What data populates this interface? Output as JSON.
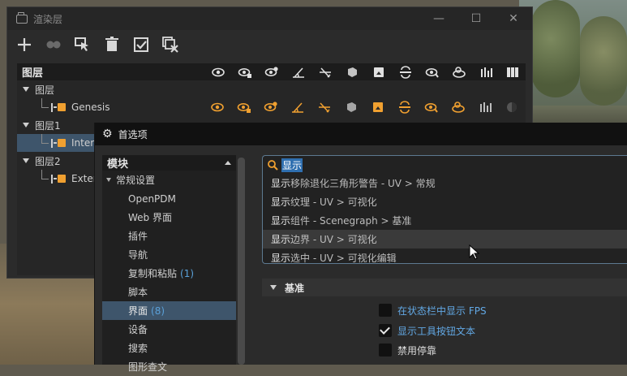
{
  "layers_window": {
    "title": "渲染层",
    "controls": {
      "minimize": "—",
      "maximize": "☐",
      "close": "✕"
    },
    "toolbar": [
      "add-icon",
      "link-icon",
      "select-render-icon",
      "delete-icon",
      "checkbox-icon",
      "clear-icon"
    ],
    "tree_header": "图层",
    "column_icons": [
      "eye-icon",
      "eye-lock-icon",
      "eye-settings-icon",
      "angle-icon",
      "angle-slash-icon",
      "cube-icon",
      "cube-fill-icon",
      "split-icon",
      "eye-pin-icon",
      "shape-icon",
      "bars-icon",
      "columns-icon"
    ],
    "rows": [
      {
        "label": "图层",
        "type": "group"
      },
      {
        "label": "Genesis",
        "type": "layer"
      },
      {
        "label": "图层1",
        "type": "group"
      },
      {
        "label": "Interi",
        "type": "layer",
        "selected": true
      },
      {
        "label": "图层2",
        "type": "group"
      },
      {
        "label": "Exteri",
        "type": "layer"
      }
    ]
  },
  "preferences": {
    "title": "首选项",
    "modules_header": "模块",
    "modules": [
      {
        "label": "常规设置",
        "parent": true
      },
      {
        "label": "OpenPDM"
      },
      {
        "label": "Web 界面"
      },
      {
        "label": "插件"
      },
      {
        "label": "导航"
      },
      {
        "label": "复制和粘贴",
        "count": "(1)"
      },
      {
        "label": "脚本"
      },
      {
        "label": "界面",
        "count": "(8)",
        "selected": true
      },
      {
        "label": "设备"
      },
      {
        "label": "搜索"
      },
      {
        "label": "图形查文"
      }
    ],
    "search": {
      "value": "显示",
      "suggestions": [
        {
          "hl": "显示",
          "rest": "移除退化三角形警告 - UV > 常规"
        },
        {
          "hl": "显示",
          "rest": "纹理 - UV > 可视化"
        },
        {
          "hl": "显示",
          "rest": "组件 - Scenegraph > 基准"
        },
        {
          "hl": "显示",
          "rest": "边界 - UV > 可视化",
          "hover": true
        },
        {
          "hl": "显示",
          "rest": "选中 - UV > 可视化编辑"
        }
      ]
    },
    "section": "基准",
    "options": [
      {
        "label": "在状态栏中显示 FPS",
        "checked": false,
        "modified": true
      },
      {
        "label": "显示工具按钮文本",
        "checked": true,
        "modified": true
      },
      {
        "label": "禁用停靠",
        "checked": false,
        "modified": false
      }
    ]
  },
  "colors": {
    "accent": "#f0a030",
    "selection": "#3e556b",
    "link": "#62a8e4"
  }
}
